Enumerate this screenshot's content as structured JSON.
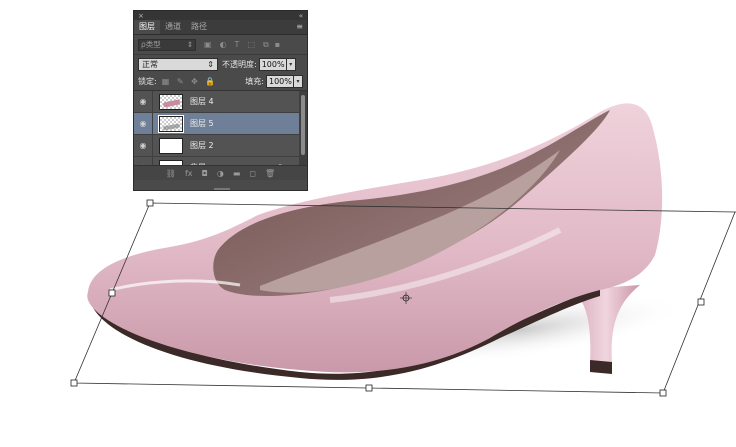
{
  "panel": {
    "close_glyph": "×",
    "collapse_glyph": "«",
    "tabs": [
      {
        "label": "图层",
        "active": true
      },
      {
        "label": "通道",
        "active": false
      },
      {
        "label": "路径",
        "active": false
      }
    ],
    "filter": {
      "label": "ρ类型",
      "icons": [
        "image-filter-icon",
        "adjustment-filter-icon",
        "type-filter-icon",
        "shape-filter-icon",
        "smart-object-filter-icon",
        "filter-toggle-icon"
      ]
    },
    "blend_mode": "正常",
    "opacity_label": "不透明度:",
    "opacity_value": "100%",
    "lock_label": "锁定:",
    "fill_label": "填充:",
    "fill_value": "100%",
    "layers": [
      {
        "name": "图层 4",
        "visible": true,
        "selected": false,
        "thumb": "shoe"
      },
      {
        "name": "图层 5",
        "visible": true,
        "selected": true,
        "thumb": "shadow"
      },
      {
        "name": "图层 2",
        "visible": true,
        "selected": false,
        "thumb": "white"
      },
      {
        "name": "背景",
        "visible": true,
        "selected": false,
        "thumb": "white",
        "locked": true
      }
    ],
    "footer_icons": [
      "link-layers-icon",
      "fx-icon",
      "add-mask-icon",
      "adjustment-layer-icon",
      "new-group-icon",
      "new-layer-icon",
      "trash-icon"
    ],
    "fx_glyph": "fx"
  },
  "colors": {
    "panel_bg": "#4a4a4a",
    "selected_layer": "#6f7f97",
    "shoe_pink": "#e4bfcb",
    "shoe_inner": "#8e6c6a",
    "sole": "#3b2a27"
  }
}
